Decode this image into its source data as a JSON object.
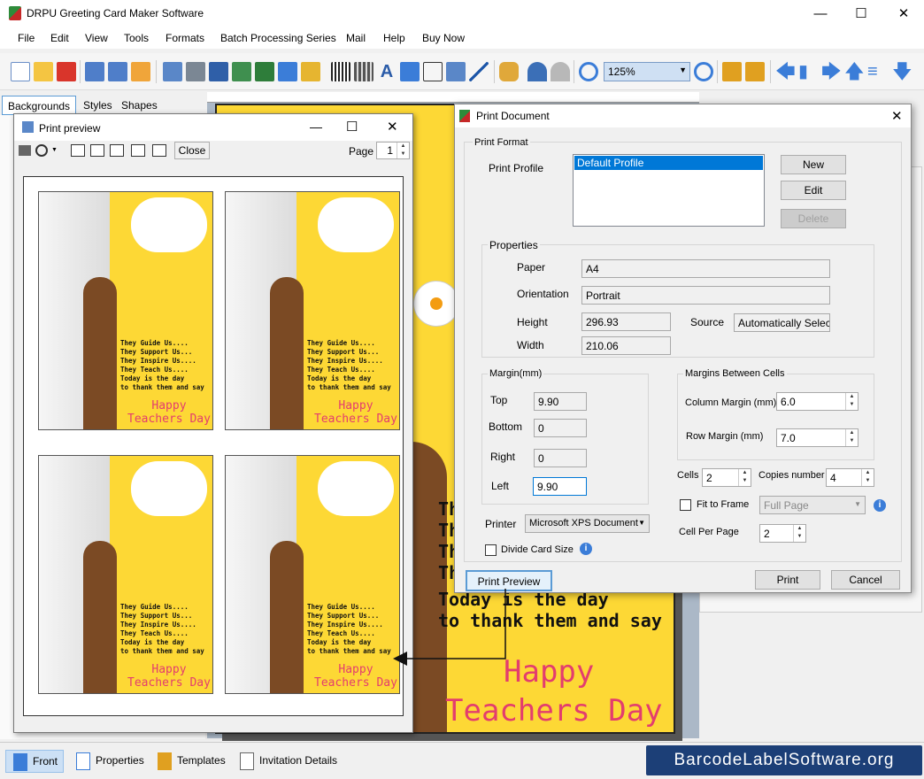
{
  "app": {
    "title": "DRPU Greeting Card Maker Software"
  },
  "menu": [
    "File",
    "Edit",
    "View",
    "Tools",
    "Formats",
    "Batch Processing Series",
    "Mail",
    "Help",
    "Buy Now"
  ],
  "toolbar": {
    "zoom": "125%"
  },
  "left_tabs": [
    "Backgrounds",
    "Styles",
    "Shapes"
  ],
  "card": {
    "lines": [
      "Th",
      "Th",
      "Th",
      "Th",
      "Today is the day",
      "to thank them and say"
    ],
    "happy": "Happy",
    "teachers": "Teachers Day"
  },
  "preview": {
    "title": "Print preview",
    "close": "Close",
    "page_label": "Page",
    "page_value": "1",
    "mini_text": "They Guide Us....\nThey Support Us...\nThey Inspire Us....\nThey Teach Us....\nToday is the day\nto thank them and say",
    "mini_happy": "Happy",
    "mini_teachers": "Teachers Day"
  },
  "dialog": {
    "title": "Print Document",
    "print_format": "Print Format",
    "print_profile_label": "Print Profile",
    "profile_selected": "Default Profile",
    "new": "New",
    "edit": "Edit",
    "delete": "Delete",
    "properties": "Properties",
    "paper_label": "Paper",
    "paper": "A4",
    "orientation_label": "Orientation",
    "orientation": "Portrait",
    "height_label": "Height",
    "height": "296.93",
    "source_label": "Source",
    "source": "Automatically Select",
    "width_label": "Width",
    "width": "210.06",
    "margin_group": "Margin(mm)",
    "top_label": "Top",
    "top": "9.90",
    "bottom_label": "Bottom",
    "bottom": "0",
    "right_label": "Right",
    "right": "0",
    "left_label": "Left",
    "left": "9.90",
    "cells_group": "Margins Between Cells",
    "column_margin_label": "Column Margin (mm)",
    "column_margin": "6.0",
    "row_margin_label": "Row Margin (mm)",
    "row_margin": "7.0",
    "cells_label": "Cells",
    "cells": "2",
    "copies_label": "Copies number",
    "copies": "4",
    "fit_label": "Fit to Frame",
    "fit_value": "Full Page",
    "cell_per_page_label": "Cell Per Page",
    "cell_per_page": "2",
    "printer_label": "Printer",
    "printer": "Microsoft XPS Document",
    "divide_label": "Divide Card Size",
    "print_preview": "Print Preview",
    "print": "Print",
    "cancel": "Cancel"
  },
  "bottom_tabs": [
    "Front",
    "Properties",
    "Templates",
    "Invitation Details"
  ],
  "brand": "BarcodeLabelSoftware.org"
}
